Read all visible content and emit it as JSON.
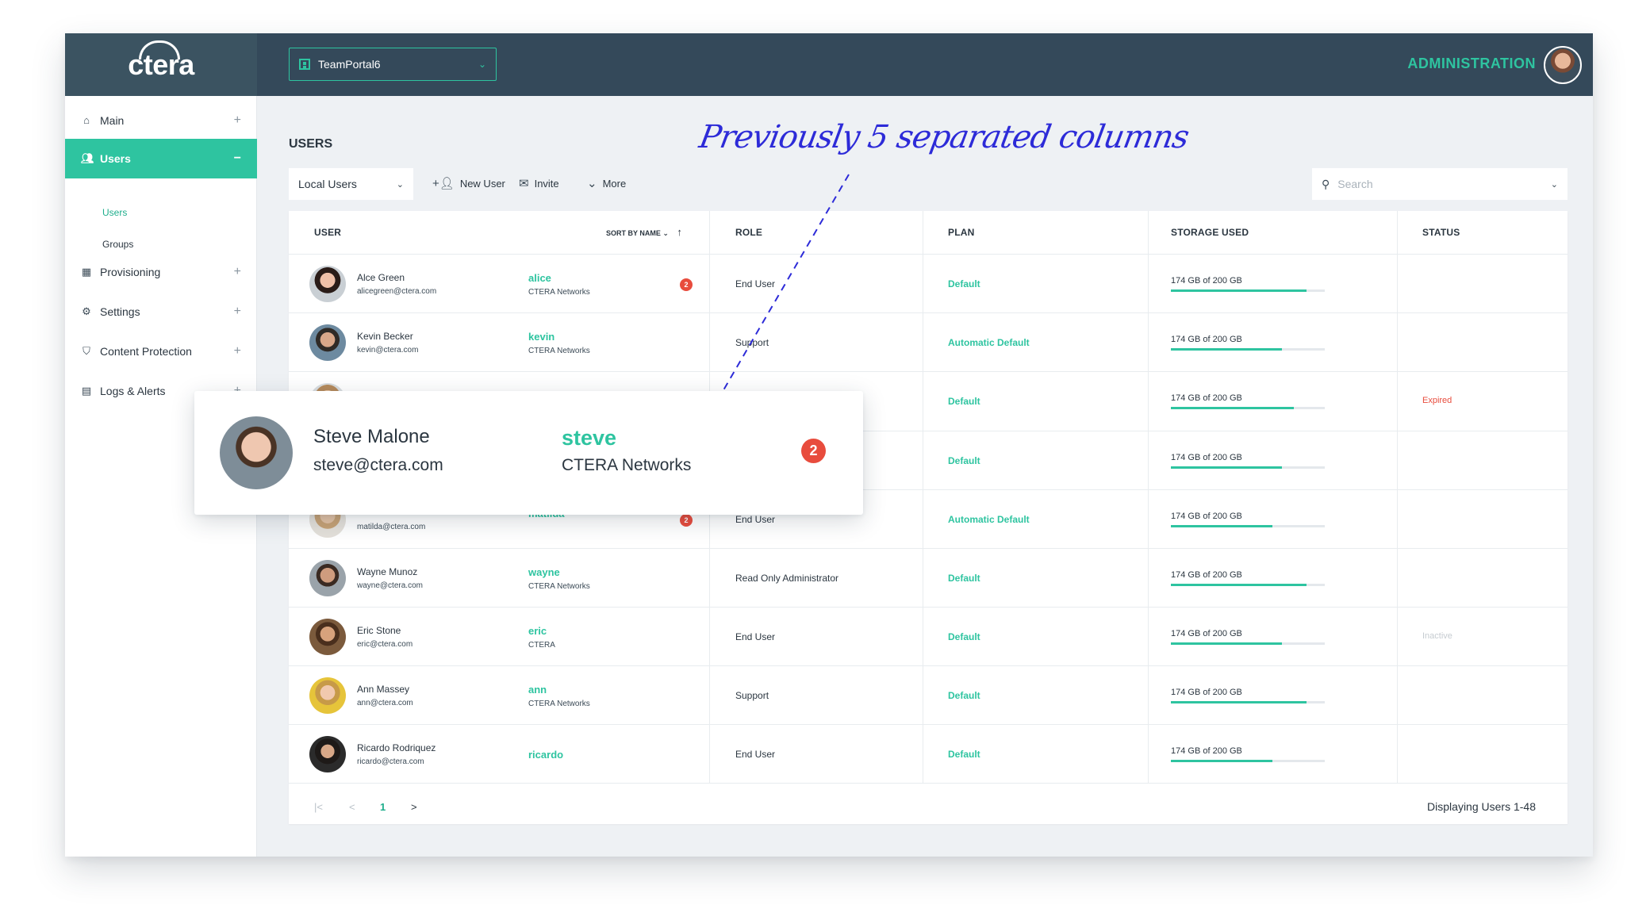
{
  "app": {
    "logo": "ctera",
    "portal": "TeamPortal6",
    "admin_label": "ADMINISTRATION"
  },
  "sidebar": {
    "items": [
      {
        "label": "Main",
        "icon": "home-icon",
        "toggle": "+"
      },
      {
        "label": "Users",
        "icon": "users-icon",
        "toggle": "−"
      },
      {
        "label": "Provisioning",
        "icon": "grid-icon",
        "toggle": "+"
      },
      {
        "label": "Settings",
        "icon": "gear-icon",
        "toggle": "+"
      },
      {
        "label": "Content Protection",
        "icon": "shield-icon",
        "toggle": "+"
      },
      {
        "label": "Logs & Alerts",
        "icon": "clipboard-icon",
        "toggle": "+"
      }
    ],
    "sub_items": [
      "Users",
      "Groups"
    ]
  },
  "page": {
    "title": "USERS",
    "annotation": "Previously 5 separated columns"
  },
  "toolbar": {
    "filter": "Local Users",
    "new_user": "New User",
    "invite": "Invite",
    "more": "More",
    "search_placeholder": "Search"
  },
  "table": {
    "headers": {
      "user": "USER",
      "sort": "SORT BY NAME",
      "role": "ROLE",
      "plan": "PLAN",
      "storage": "STORAGE USED",
      "status": "STATUS"
    },
    "rows": [
      {
        "name": "Alce Green",
        "email": "alicegreen@ctera.com",
        "username": "alice",
        "org": "CTERA Networks",
        "badge": "2",
        "role": "End User",
        "plan": "Default",
        "storage": "174 GB of 200 GB",
        "usage": 0.88,
        "status": ""
      },
      {
        "name": "Kevin Becker",
        "email": "kevin@ctera.com",
        "username": "kevin",
        "org": "CTERA Networks",
        "badge": "",
        "role": "Support",
        "plan": "Automatic Default",
        "storage": "174 GB of 200 GB",
        "usage": 0.72,
        "status": ""
      },
      {
        "name": "",
        "email": "",
        "username": "",
        "org": "",
        "badge": "",
        "role": "",
        "plan": "Default",
        "storage": "174 GB of 200 GB",
        "usage": 0.8,
        "status": "Expired"
      },
      {
        "name": "",
        "email": "",
        "username": "",
        "org": "",
        "badge": "",
        "role": "",
        "plan": "Default",
        "storage": "174 GB of 200 GB",
        "usage": 0.72,
        "status": ""
      },
      {
        "name": "",
        "email": "matilda@ctera.com",
        "username": "matilda",
        "org": "",
        "badge": "2",
        "role": "End User",
        "plan": "Automatic Default",
        "storage": "174 GB of 200 GB",
        "usage": 0.66,
        "status": ""
      },
      {
        "name": "Wayne Munoz",
        "email": "wayne@ctera.com",
        "username": "wayne",
        "org": "CTERA Networks",
        "badge": "",
        "role": "Read Only Administrator",
        "plan": "Default",
        "storage": "174 GB of 200 GB",
        "usage": 0.88,
        "status": ""
      },
      {
        "name": "Eric Stone",
        "email": "eric@ctera.com",
        "username": "eric",
        "org": "CTERA",
        "badge": "",
        "role": "End User",
        "plan": "Default",
        "storage": "174 GB of 200 GB",
        "usage": 0.72,
        "status": "Inactive"
      },
      {
        "name": "Ann Massey",
        "email": "ann@ctera.com",
        "username": "ann",
        "org": "CTERA Networks",
        "badge": "",
        "role": "Support",
        "plan": "Default",
        "storage": "174 GB of 200 GB",
        "usage": 0.88,
        "status": ""
      },
      {
        "name": "Ricardo Rodriquez",
        "email": "ricardo@ctera.com",
        "username": "ricardo",
        "org": "",
        "badge": "",
        "role": "End User",
        "plan": "Default",
        "storage": "174 GB of 200 GB",
        "usage": 0.66,
        "status": ""
      }
    ]
  },
  "pagination": {
    "first": "|<",
    "prev": "<",
    "current": "1",
    "next": ">",
    "summary": "Displaying Users 1-48"
  },
  "popup": {
    "name": "Steve Malone",
    "email": "steve@ctera.com",
    "username": "steve",
    "org": "CTERA Networks",
    "badge": "2"
  },
  "colors": {
    "accent": "#2ec4a0",
    "header": "#34495a",
    "badge": "#e84c3d",
    "annotation": "#2d2bd8"
  }
}
